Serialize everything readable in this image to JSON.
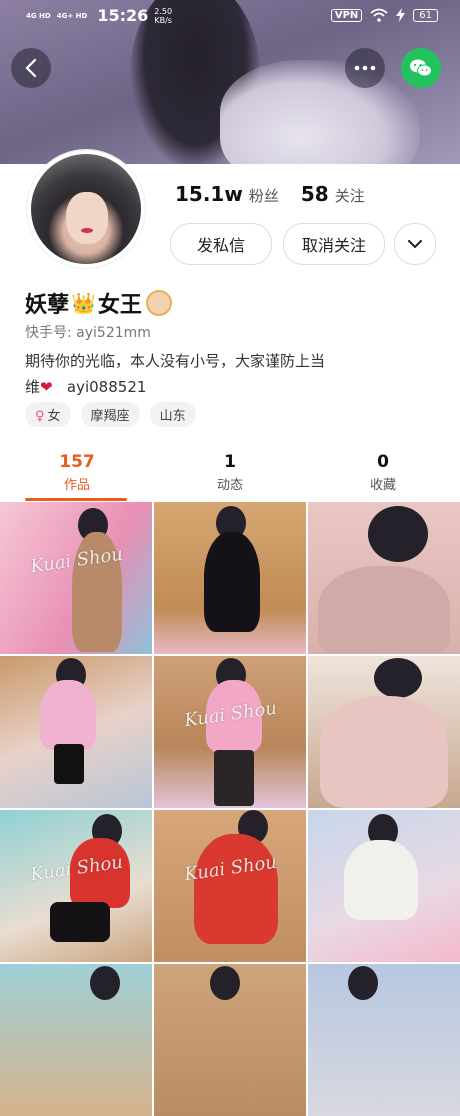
{
  "status_bar": {
    "signal_1": "4G HD",
    "signal_2": "4G+ HD",
    "time": "15:26",
    "speed_value": "2.50",
    "speed_unit": "KB/s",
    "vpn": "VPN",
    "battery": "61"
  },
  "profile": {
    "followers_count": "15.1w",
    "followers_label": "粉丝",
    "following_count": "58",
    "following_label": "关注",
    "message_button": "发私信",
    "unfollow_button": "取消关注",
    "name_part1": "妖孽",
    "name_crown": "👑",
    "name_part2": "女王",
    "kuaishou_id": "快手号: ayi521mm",
    "bio_line1": "期待你的光临，本人没有小号，大家谨防上当",
    "bio_line2": "维",
    "bio_heart": "❤",
    "bio_contact": "ayi088521",
    "tags": {
      "gender_symbol": "♀",
      "gender": "女",
      "zodiac": "摩羯座",
      "region": "山东"
    }
  },
  "tabs": [
    {
      "count": "157",
      "label": "作品"
    },
    {
      "count": "1",
      "label": "动态"
    },
    {
      "count": "0",
      "label": "收藏"
    }
  ],
  "tab_active": "作品",
  "watermark": "Kuai Shou",
  "colors": {
    "accent": "#e85d1f",
    "wechat": "#22c35e",
    "heart": "#d11f3a"
  },
  "icons": [
    "back-chevron-icon",
    "more-dots-icon",
    "wechat-icon",
    "chevron-down-icon",
    "wifi-icon",
    "charging-icon"
  ]
}
